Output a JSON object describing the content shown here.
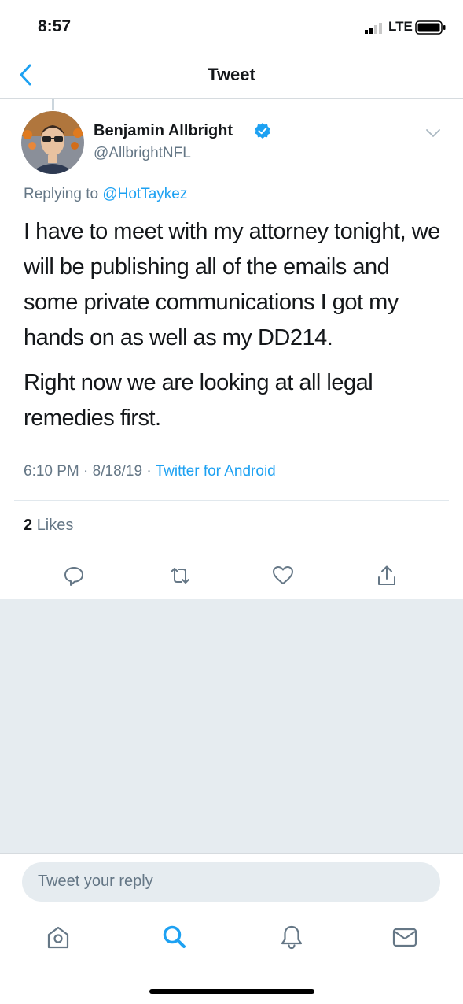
{
  "status_bar": {
    "time": "8:57",
    "network": "LTE"
  },
  "nav": {
    "title": "Tweet",
    "back_icon": "chevron-left-icon"
  },
  "tweet": {
    "author_name": "Benjamin Allbright",
    "author_handle": "@AllbrightNFL",
    "replying_prefix": "Replying to",
    "replying_to": "@HotTaykez",
    "paragraph1": "I have to meet with my attorney tonight, we will be publishing all of the emails and some private communications I got my hands on as well as my DD214.",
    "paragraph2": "Right now we are looking at all legal remedies first.",
    "time": "6:10 PM",
    "date": "8/18/19",
    "source": "Twitter for Android",
    "likes_count": "2",
    "likes_label": "Likes"
  },
  "actions": [
    "reply-icon",
    "retweet-icon",
    "like-icon",
    "share-icon"
  ],
  "compose": {
    "placeholder": "Tweet your reply"
  },
  "tab_bar": [
    "home-icon",
    "search-icon",
    "notifications-icon",
    "messages-icon"
  ],
  "colors": {
    "accent": "#1da1f2",
    "secondary_text": "#657786",
    "background_gray": "#e6ecf0"
  }
}
